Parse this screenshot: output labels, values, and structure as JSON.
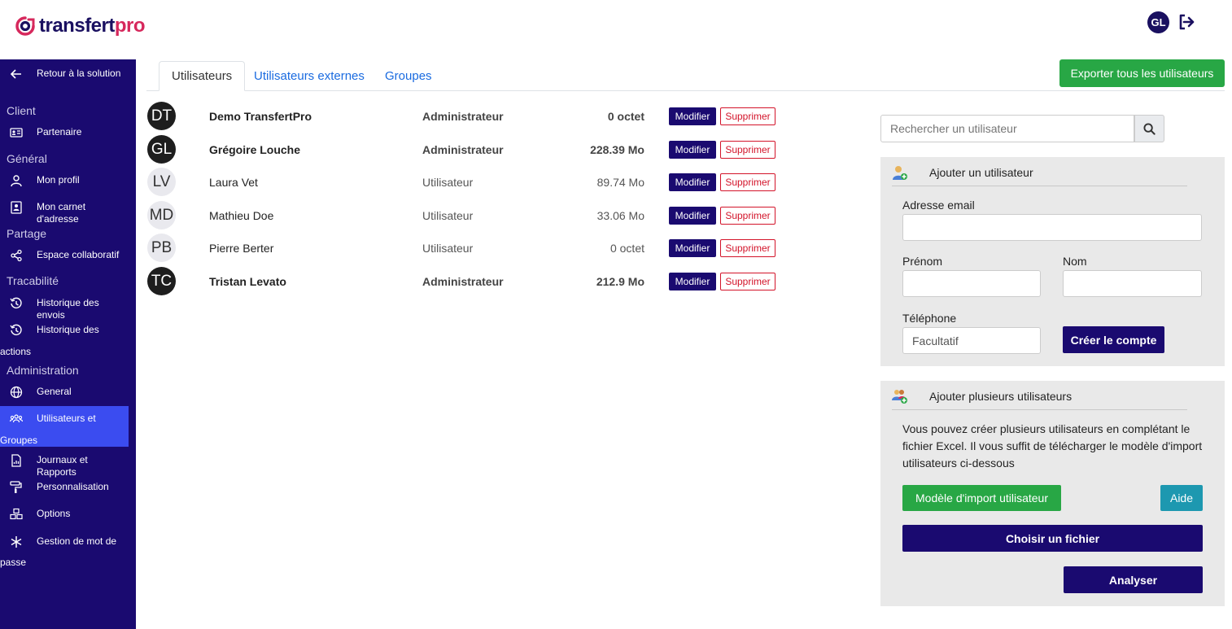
{
  "header": {
    "logo_main": "transfert",
    "logo_accent": "pro",
    "user_initials": "GL"
  },
  "sidebar": {
    "back": "Retour à la solution",
    "sections": {
      "client": "Client",
      "general": "Général",
      "partage": "Partage",
      "tracabilite": "Tracabilité",
      "administration": "Administration"
    },
    "items": {
      "partenaire": "Partenaire",
      "mon_profil": "Mon profil",
      "carnet": "Mon carnet d'adresse",
      "espace": "Espace collaboratif",
      "historique_envois": "Historique des envois",
      "historique_actions_1": "Historique des",
      "historique_actions_2": "actions",
      "general": "General",
      "utilisateurs_1": "Utilisateurs et",
      "utilisateurs_2": "Groupes",
      "journaux": "Journaux et Rapports",
      "personnalisation": "Personnalisation",
      "options": "Options",
      "mdp_1": "Gestion de mot de",
      "mdp_2": "passe"
    }
  },
  "tabs": [
    "Utilisateurs",
    "Utilisateurs externes",
    "Groupes"
  ],
  "export_label": "Exporter tous les utilisateurs",
  "users": [
    {
      "initials": "DT",
      "name": "Demo TransfertPro",
      "role": "Administrateur",
      "size": "0 octet"
    },
    {
      "initials": "GL",
      "name": "Grégoire Louche",
      "role": "Administrateur",
      "size": "228.39 Mo"
    },
    {
      "initials": "LV",
      "name": "Laura Vet",
      "role": "Utilisateur",
      "size": "89.74 Mo"
    },
    {
      "initials": "MD",
      "name": "Mathieu Doe",
      "role": "Utilisateur",
      "size": "33.06 Mo"
    },
    {
      "initials": "PB",
      "name": "Pierre Berter",
      "role": "Utilisateur",
      "size": "0 octet"
    },
    {
      "initials": "TC",
      "name": "Tristan Levato",
      "role": "Administrateur",
      "size": "212.9 Mo"
    }
  ],
  "row_actions": {
    "modify": "Modifier",
    "delete": "Supprimer"
  },
  "search": {
    "placeholder": "Rechercher un utilisateur"
  },
  "add_user": {
    "title": "Ajouter un utilisateur",
    "email_label": "Adresse email",
    "firstname_label": "Prénom",
    "lastname_label": "Nom",
    "phone_label": "Téléphone",
    "phone_placeholder": "Facultatif",
    "create_button": "Créer le compte"
  },
  "add_multiple": {
    "title": "Ajouter plusieurs utilisateurs",
    "description": "Vous pouvez créer plusieurs utilisateurs en complétant le fichier Excel. Il vous suffit de télécharger le modèle d'import utilisateurs ci-dessous",
    "template_button": "Modèle d'import utilisateur",
    "help_button": "Aide",
    "choose_file_button": "Choisir un fichier",
    "analyze_button": "Analyser"
  }
}
